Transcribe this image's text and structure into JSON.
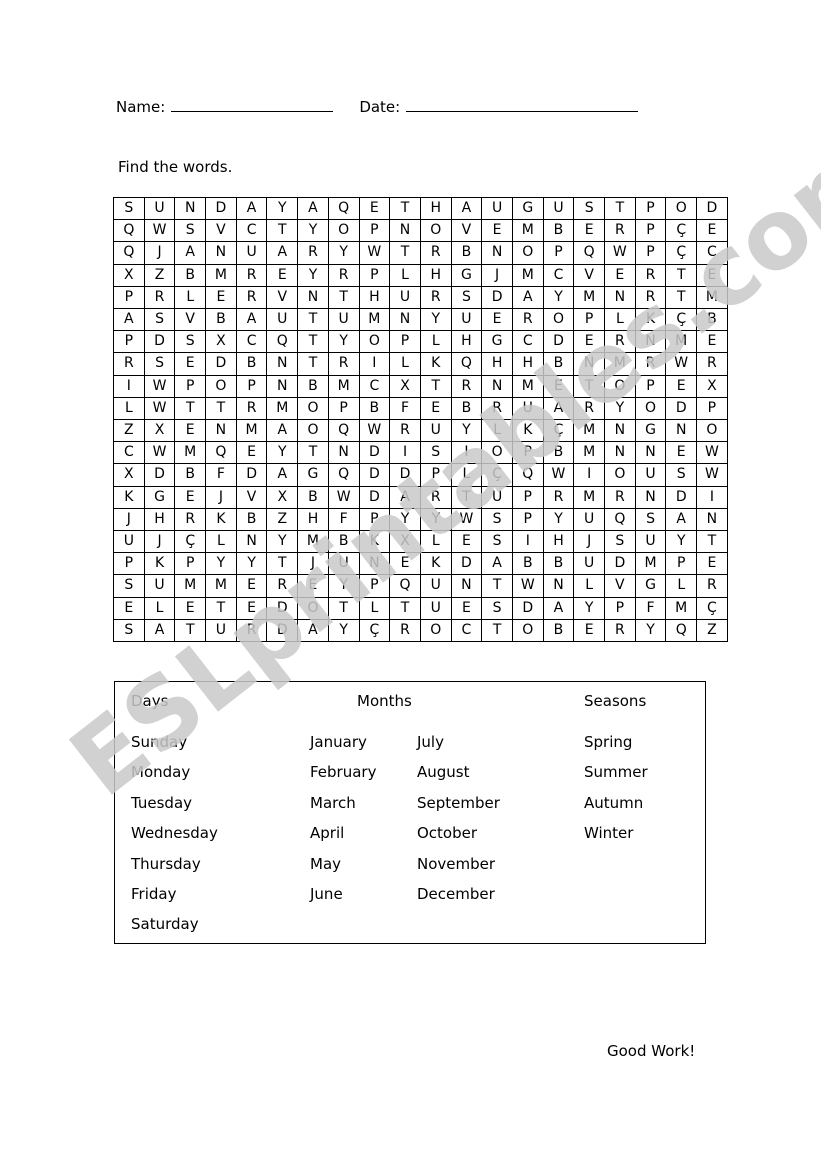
{
  "header": {
    "name_label": "Name:",
    "date_label": "Date:"
  },
  "instruction": "Find the words.",
  "footer": {
    "note": "Good Work!"
  },
  "watermark": {
    "text": "ESLprintables.com",
    "color": "#c9c9c9"
  },
  "grid": {
    "rows": 20,
    "cols": 20,
    "letters": [
      [
        "S",
        "U",
        "N",
        "D",
        "A",
        "Y",
        "A",
        "Q",
        "E",
        "T",
        "H",
        "A",
        "U",
        "G",
        "U",
        "S",
        "T",
        "P",
        "O",
        "D"
      ],
      [
        "Q",
        "W",
        "S",
        "V",
        "C",
        "T",
        "Y",
        "O",
        "P",
        "N",
        "O",
        "V",
        "E",
        "M",
        "B",
        "E",
        "R",
        "P",
        "Ç",
        "E"
      ],
      [
        "Q",
        "J",
        "A",
        "N",
        "U",
        "A",
        "R",
        "Y",
        "W",
        "T",
        "R",
        "B",
        "N",
        "O",
        "P",
        "Q",
        "W",
        "P",
        "Ç",
        "C"
      ],
      [
        "X",
        "Z",
        "B",
        "M",
        "R",
        "E",
        "Y",
        "R",
        "P",
        "L",
        "H",
        "G",
        "J",
        "M",
        "C",
        "V",
        "E",
        "R",
        "T",
        "E"
      ],
      [
        "P",
        "R",
        "L",
        "E",
        "R",
        "V",
        "N",
        "T",
        "H",
        "U",
        "R",
        "S",
        "D",
        "A",
        "Y",
        "M",
        "N",
        "R",
        "T",
        "M"
      ],
      [
        "A",
        "S",
        "V",
        "B",
        "A",
        "U",
        "T",
        "U",
        "M",
        "N",
        "Y",
        "U",
        "E",
        "R",
        "O",
        "P",
        "L",
        "K",
        "Ç",
        "B"
      ],
      [
        "P",
        "D",
        "S",
        "X",
        "C",
        "Q",
        "T",
        "Y",
        "O",
        "P",
        "L",
        "H",
        "G",
        "C",
        "D",
        "E",
        "R",
        "N",
        "M",
        "E"
      ],
      [
        "R",
        "S",
        "E",
        "D",
        "B",
        "N",
        "T",
        "R",
        "I",
        "L",
        "K",
        "Q",
        "H",
        "H",
        "B",
        "N",
        "M",
        "R",
        "W",
        "R"
      ],
      [
        "I",
        "W",
        "P",
        "O",
        "P",
        "N",
        "B",
        "M",
        "C",
        "X",
        "T",
        "R",
        "N",
        "M",
        "E",
        "T",
        "O",
        "P",
        "E",
        "X"
      ],
      [
        "L",
        "W",
        "T",
        "T",
        "R",
        "M",
        "O",
        "P",
        "B",
        "F",
        "E",
        "B",
        "R",
        "U",
        "A",
        "R",
        "Y",
        "O",
        "D",
        "P"
      ],
      [
        "Z",
        "X",
        "E",
        "N",
        "M",
        "A",
        "O",
        "Q",
        "W",
        "R",
        "U",
        "Y",
        "L",
        "K",
        "Ç",
        "M",
        "N",
        "G",
        "N",
        "O"
      ],
      [
        "C",
        "W",
        "M",
        "Q",
        "E",
        "Y",
        "T",
        "N",
        "D",
        "I",
        "S",
        "I",
        "O",
        "P",
        "B",
        "M",
        "N",
        "N",
        "E",
        "W"
      ],
      [
        "X",
        "D",
        "B",
        "F",
        "D",
        "A",
        "G",
        "Q",
        "D",
        "D",
        "P",
        "L",
        "Ç",
        "Q",
        "W",
        "I",
        "O",
        "U",
        "S",
        "W"
      ],
      [
        "K",
        "G",
        "E",
        "J",
        "V",
        "X",
        "B",
        "W",
        "D",
        "A",
        "R",
        "T",
        "U",
        "P",
        "R",
        "M",
        "R",
        "N",
        "D",
        "I"
      ],
      [
        "J",
        "H",
        "R",
        "K",
        "B",
        "Z",
        "H",
        "F",
        "P",
        "Y",
        "Y",
        "W",
        "S",
        "P",
        "Y",
        "U",
        "Q",
        "S",
        "A",
        "N"
      ],
      [
        "U",
        "J",
        "Ç",
        "L",
        "N",
        "Y",
        "M",
        "B",
        "K",
        "X",
        "L",
        "E",
        "S",
        "I",
        "H",
        "J",
        "S",
        "U",
        "Y",
        "T"
      ],
      [
        "P",
        "K",
        "P",
        "Y",
        "Y",
        "T",
        "J",
        "U",
        "N",
        "E",
        "K",
        "D",
        "A",
        "B",
        "B",
        "U",
        "D",
        "M",
        "P",
        "E"
      ],
      [
        "S",
        "U",
        "M",
        "M",
        "E",
        "R",
        "E",
        "Y",
        "P",
        "Q",
        "U",
        "N",
        "T",
        "W",
        "N",
        "L",
        "V",
        "G",
        "L",
        "R"
      ],
      [
        "E",
        "L",
        "E",
        "T",
        "E",
        "D",
        "O",
        "T",
        "L",
        "T",
        "U",
        "E",
        "S",
        "D",
        "A",
        "Y",
        "P",
        "F",
        "M",
        "Ç"
      ],
      [
        "S",
        "A",
        "T",
        "U",
        "R",
        "D",
        "A",
        "Y",
        "Ç",
        "R",
        "O",
        "C",
        "T",
        "O",
        "B",
        "E",
        "R",
        "Y",
        "Q",
        "Z"
      ]
    ]
  },
  "wordlist": {
    "headings": {
      "days": "Days",
      "months": "Months",
      "seasons": "Seasons"
    },
    "days": [
      "Sunday",
      "Monday",
      "Tuesday",
      "Wednesday",
      "Thursday",
      "Friday",
      "Saturday"
    ],
    "months_col1": [
      "January",
      "February",
      "March",
      "April",
      "May",
      "June"
    ],
    "months_col2": [
      "July",
      "August",
      "September",
      "October",
      "November",
      "December"
    ],
    "seasons": [
      "Spring",
      "Summer",
      "Autumn",
      "Winter"
    ]
  }
}
